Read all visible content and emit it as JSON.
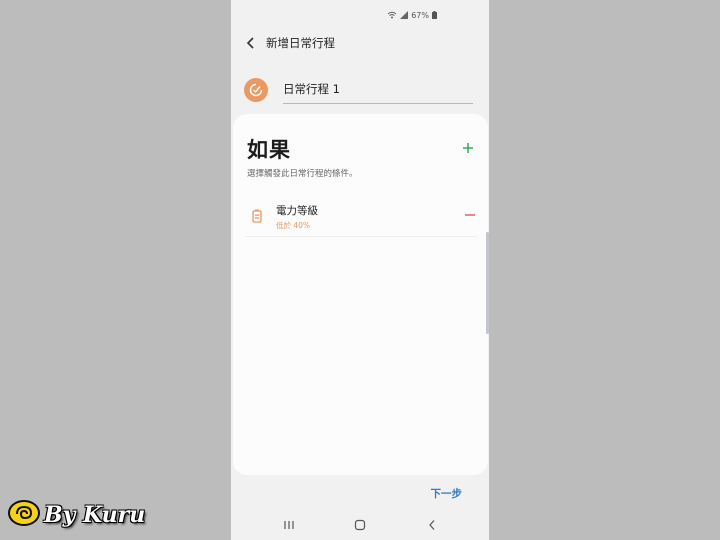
{
  "status_bar": {
    "battery_percent": "67%",
    "icons": [
      "wifi-icon",
      "signal-icon",
      "battery-icon"
    ]
  },
  "header": {
    "back_icon": "back-arrow-icon",
    "title": "新增日常行程"
  },
  "routine": {
    "icon": "routine-check-icon",
    "name_value": "日常行程 1",
    "accent_color": "#e99a63"
  },
  "if_section": {
    "title": "如果",
    "description": "選擇觸發此日常行程的條件。",
    "add_icon": "plus-icon",
    "add_color": "#2aa553",
    "conditions": [
      {
        "icon": "battery-icon",
        "title": "電力等級",
        "subtitle": "低於 40%",
        "remove_icon": "minus-icon",
        "remove_color": "#e0565a"
      }
    ]
  },
  "footer": {
    "next_label": "下一步",
    "next_color": "#2f7dc3"
  },
  "nav_bar": {
    "items": [
      "recents-icon",
      "home-icon",
      "back-icon"
    ]
  },
  "watermark": {
    "text": "By Kuru"
  }
}
